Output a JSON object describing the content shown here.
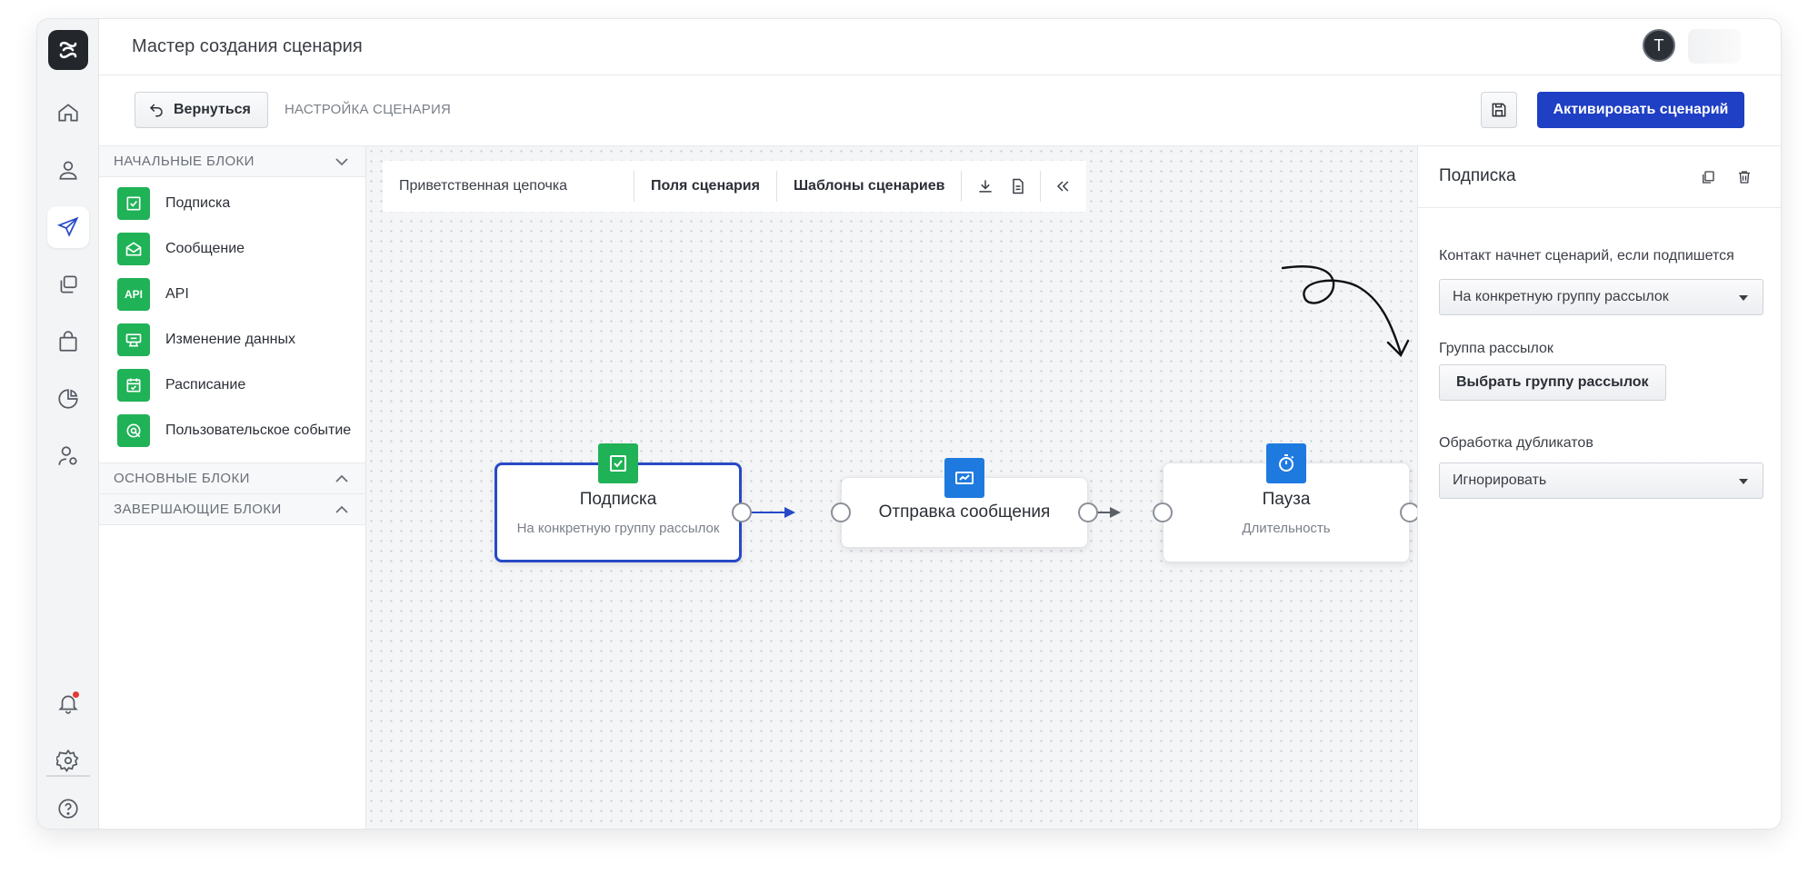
{
  "header": {
    "title": "Мастер создания сценария",
    "avatar_initial": "T"
  },
  "toolbar": {
    "back_label": "Вернуться",
    "breadcrumb": "НАСТРОЙКА СЦЕНАРИЯ",
    "activate_label": "Активировать сценарий"
  },
  "blocks": {
    "start_title": "НАЧАЛЬНЫЕ БЛОКИ",
    "start_items": [
      {
        "label": "Подписка",
        "icon": "check-square-icon"
      },
      {
        "label": "Сообщение",
        "icon": "envelope-open-icon"
      },
      {
        "label": "API",
        "icon": "api-icon",
        "icon_text": "API"
      },
      {
        "label": "Изменение данных",
        "icon": "data-change-icon"
      },
      {
        "label": "Расписание",
        "icon": "calendar-icon"
      },
      {
        "label": "Пользовательское событие",
        "icon": "custom-event-icon"
      }
    ],
    "main_title": "ОСНОВНЫЕ БЛОКИ",
    "final_title": "ЗАВЕРШАЮЩИЕ БЛОКИ"
  },
  "canvas": {
    "chain_name": "Приветственная цепочка",
    "fields_label": "Поля сценария",
    "templates_label": "Шаблоны сценариев",
    "nodes": [
      {
        "title": "Подписка",
        "subtitle": "На конкретную группу рассылок",
        "badge_color": "#20b257",
        "badge_icon": "check-square-icon"
      },
      {
        "title": "Отправка сообщения",
        "badge_color": "#1f7ae0",
        "badge_icon": "message-icon"
      },
      {
        "title": "Пауза",
        "subtitle": "Длительность",
        "badge_color": "#1f7ae0",
        "badge_icon": "stopwatch-icon"
      }
    ]
  },
  "props": {
    "title": "Подписка",
    "trigger_label": "Контакт начнет сценарий, если подпишется",
    "trigger_value": "На конкретную группу рассылок",
    "group_label": "Группа рассылок",
    "group_button": "Выбрать группу рассылок",
    "dup_label": "Обработка дубликатов",
    "dup_value": "Игнорировать"
  },
  "colors": {
    "accent": "#1f3fc4",
    "selected_border": "#2849c6",
    "green": "#20b257",
    "blue": "#1f7ae0"
  }
}
